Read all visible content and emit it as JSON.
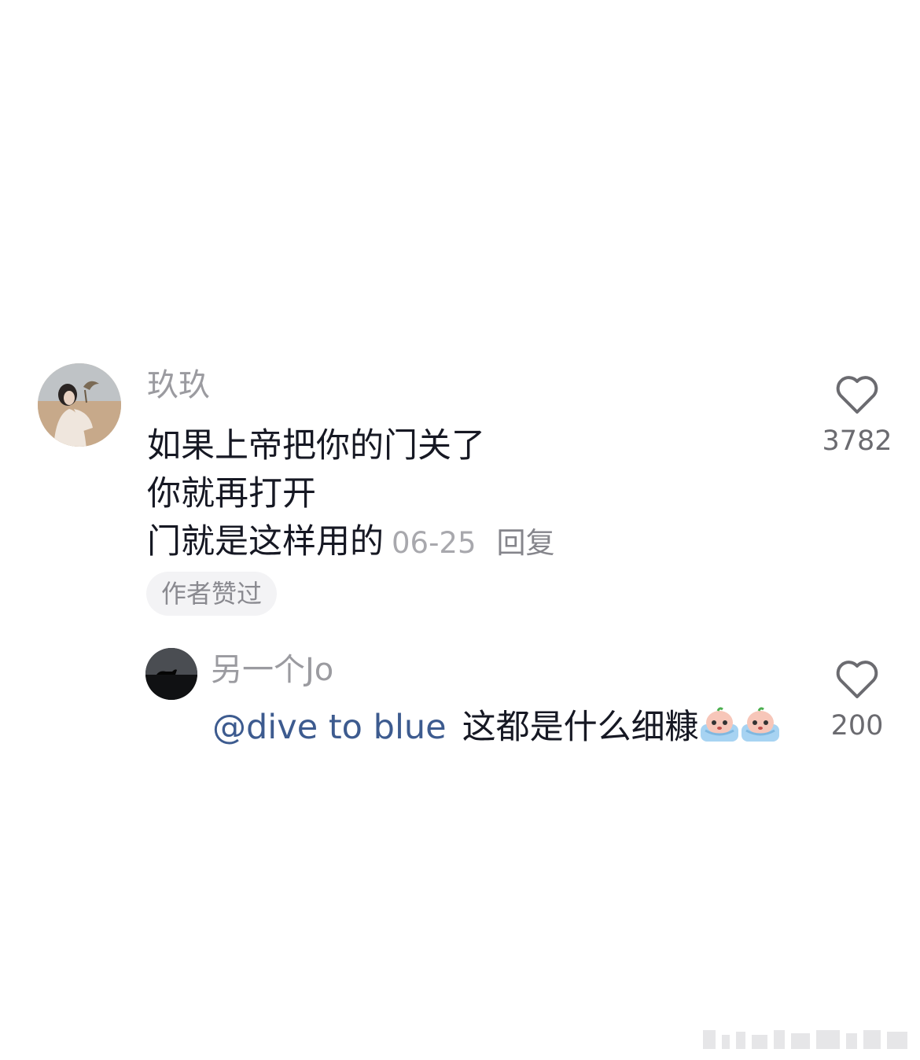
{
  "comment": {
    "username": "玖玖",
    "lines": [
      "如果上帝把你的门关了",
      "你就再打开",
      "门就是这样用的"
    ],
    "time": "06-25",
    "reply_label": "回复",
    "author_liked_badge": "作者赞过",
    "likes": "3782"
  },
  "reply": {
    "username": "另一个Jo",
    "mention": "@dive to blue",
    "text": "这都是什么细糠",
    "emojis": [
      "crying-emoji",
      "crying-emoji"
    ],
    "likes": "200"
  },
  "icons": {
    "like": "heart-outline-icon"
  },
  "colors": {
    "username": "#9b9ba0",
    "mention": "#3d5b8f",
    "text": "#161823"
  }
}
